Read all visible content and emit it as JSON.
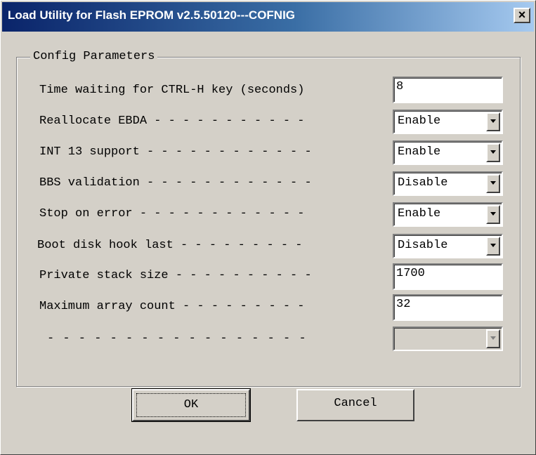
{
  "window": {
    "title": "Load Utility for Flash EPROM v2.5.50120---COFNIG",
    "close_label": "×"
  },
  "group": {
    "title": "Config Parameters"
  },
  "params": [
    {
      "label": "Time waiting for CTRL-H key (seconds)",
      "type": "text",
      "value": "8"
    },
    {
      "label": "Reallocate EBDA - - - - - - - - - - -",
      "type": "select",
      "value": "Enable"
    },
    {
      "label": "INT 13 support - - - - - - - - - - - -",
      "type": "select",
      "value": "Enable"
    },
    {
      "label": "BBS validation - - - - - - - - - - - -",
      "type": "select",
      "value": "Disable"
    },
    {
      "label": "Stop on error - - - - - - - - - - - -",
      "type": "select",
      "value": "Enable"
    },
    {
      "label": "Boot disk hook last - - - - - - - - -",
      "type": "select",
      "value": "Disable"
    },
    {
      "label": "Private stack size - - - - - - - - - -",
      "type": "text",
      "value": "1700"
    },
    {
      "label": "Maximum array count - - - - - - - - -",
      "type": "text",
      "value": "32"
    },
    {
      "label": "- - - - - - - - - - - - - - - - -",
      "type": "select",
      "value": "",
      "disabled": true
    }
  ],
  "buttons": {
    "ok": "OK",
    "cancel": "Cancel"
  }
}
